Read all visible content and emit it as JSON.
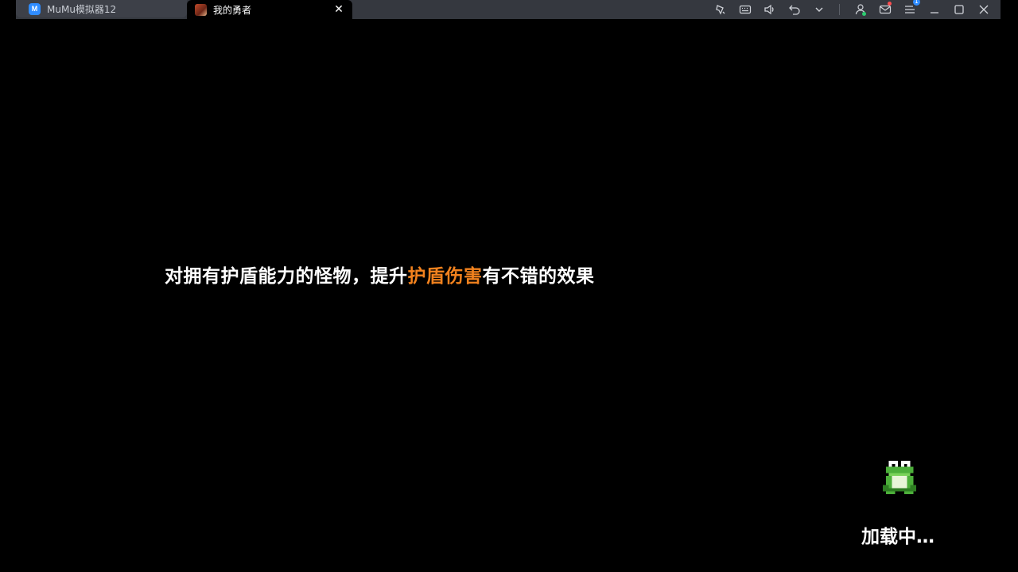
{
  "tabs": [
    {
      "label": "MuMu模拟器12",
      "icon": "mumu-logo-icon"
    },
    {
      "label": "我的勇者",
      "icon": "game-logo-icon",
      "close": "✕"
    }
  ],
  "toolbar": [
    "shake-icon",
    "keyboard-icon",
    "volume-icon",
    "back-icon",
    "chevron-down-icon",
    "account-icon",
    "mail-icon",
    "menu-icon",
    "minimize-icon",
    "maximize-icon",
    "close-window-icon"
  ],
  "toolbar_badges": {
    "menu_count": "1"
  },
  "game": {
    "tip_part1": "对拥有护盾能力的怪物，提升",
    "tip_highlight": "护盾伤害",
    "tip_part2": "有不错的效果",
    "loading_text": "加载中…"
  },
  "colors": {
    "background": "#000000",
    "titlebar": "#35383f",
    "highlight": "#f2821e",
    "accent": "#2f8cff"
  }
}
